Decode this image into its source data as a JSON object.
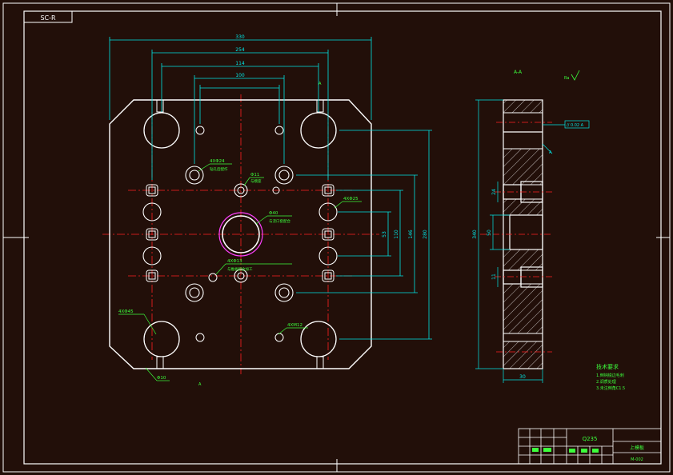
{
  "colors": {
    "background": "#220f09",
    "outline": "#ffffff",
    "dimension": "#00e5e5",
    "centerline": "#ff2020",
    "annotation": "#3cff3c",
    "bore": "#ff40ff"
  },
  "sheet": {
    "code_tag": "SC-R",
    "section_label": "A-A",
    "roughness_note": "Ra"
  },
  "plan_view": {
    "dims_horizontal": [
      "330",
      "254",
      "114",
      "100"
    ],
    "dims_vertical": [
      "280",
      "146",
      "110",
      "53"
    ],
    "callouts": [
      {
        "id": "c1",
        "text": "4XΦ24",
        "sub": "钻孔后配作"
      },
      {
        "id": "c2",
        "text": "Φ11",
        "sub": "与模座"
      },
      {
        "id": "c3",
        "text": "Φ40",
        "sub": "与浇口套配合"
      },
      {
        "id": "c4",
        "text": "4XΦ25",
        "sub": ""
      },
      {
        "id": "c5",
        "text": "4XΦ13",
        "sub": "与推板配合加工"
      },
      {
        "id": "c6",
        "text": "4XΦ45",
        "sub": ""
      },
      {
        "id": "c7",
        "text": "4XM12",
        "sub": ""
      },
      {
        "id": "c8",
        "text": "Φ10",
        "sub": ""
      }
    ],
    "small_marks": [
      "A",
      "A"
    ]
  },
  "section_view": {
    "dims": [
      "340",
      "50",
      "24",
      "11",
      "30"
    ],
    "tolerance_box": "// 0.02 A",
    "datum_label": "A"
  },
  "technical_requirements": {
    "title": "技术要求",
    "items": [
      "1.倒钝锐边毛刺",
      "2.调质处理",
      "3.未注倒角C1.5"
    ]
  },
  "title_block": {
    "material": "Q235",
    "part_name": "上模板",
    "drawing_no": "M-002"
  }
}
